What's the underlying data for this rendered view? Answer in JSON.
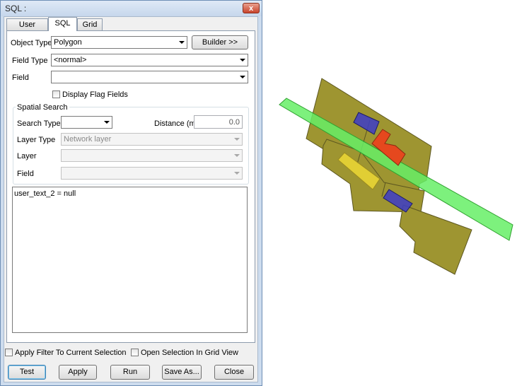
{
  "window": {
    "title": "SQL :",
    "close_glyph": "x"
  },
  "tabs": [
    {
      "label": "User Macros",
      "active": false
    },
    {
      "label": "SQL",
      "active": true
    },
    {
      "label": "Grid",
      "active": false
    }
  ],
  "form": {
    "object_type": {
      "label": "Object Type",
      "value": "Polygon"
    },
    "builder_button": "Builder >>",
    "field_type": {
      "label": "Field Type",
      "value": "<normal>"
    },
    "field": {
      "label": "Field",
      "value": ""
    },
    "display_flag_fields": {
      "label": "Display Flag Fields",
      "checked": false
    }
  },
  "spatial_search": {
    "legend": "Spatial Search",
    "search_type": {
      "label": "Search Type",
      "value": ""
    },
    "distance": {
      "label": "Distance (m)",
      "value": "0.0"
    },
    "layer_type": {
      "label": "Layer Type",
      "value": "Network layer"
    },
    "layer": {
      "label": "Layer",
      "value": ""
    },
    "field": {
      "label": "Field",
      "value": ""
    }
  },
  "sql_text": "user_text_2 = null",
  "options": {
    "apply_filter": {
      "label": "Apply Filter To Current Selection",
      "checked": false
    },
    "open_in_grid": {
      "label": "Open Selection In Grid View",
      "checked": false
    }
  },
  "buttons": {
    "test": "Test",
    "apply": "Apply",
    "run": "Run",
    "save_as": "Save As...",
    "close": "Close"
  },
  "map": {
    "colors": {
      "polygon": "#9e9531",
      "polygon_stroke": "#5c5620",
      "green": "#66ee66",
      "blue": "#3c3cc8",
      "red": "#e5481e",
      "yellow": "#e8d435"
    }
  }
}
